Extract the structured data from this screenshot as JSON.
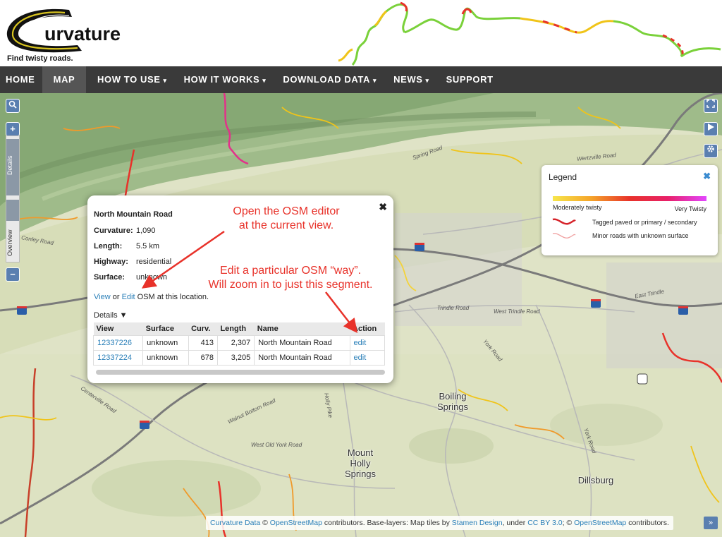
{
  "brand": {
    "name": "urvature",
    "tagline": "Find twisty roads."
  },
  "nav": [
    {
      "label": "HOME",
      "dropdown": false,
      "active": false
    },
    {
      "label": "MAP",
      "dropdown": false,
      "active": true
    },
    {
      "label": "HOW TO USE",
      "dropdown": true,
      "active": false
    },
    {
      "label": "HOW IT WORKS",
      "dropdown": true,
      "active": false
    },
    {
      "label": "DOWNLOAD DATA",
      "dropdown": true,
      "active": false
    },
    {
      "label": "NEWS",
      "dropdown": true,
      "active": false
    },
    {
      "label": "SUPPORT",
      "dropdown": false,
      "active": false
    }
  ],
  "map_controls": {
    "search_icon": "search-icon",
    "zoom_in": "+",
    "zoom_out": "−",
    "sidebar_tabs": [
      "Details",
      "Overview"
    ],
    "right_buttons": [
      "fullscreen-icon",
      "play-icon",
      "gear-icon"
    ]
  },
  "places": {
    "boiling_springs": "Boiling\nSprings",
    "mount_holly": "Mount\nHolly\nSprings",
    "dillsburg": "Dillsburg"
  },
  "road_labels": {
    "wertzville": "Wertzville Road",
    "spring": "Spring Road",
    "east_trindle": "East Trindle",
    "trindle": "Trindle Road",
    "west_trindle": "West Trindle Road",
    "york": "York Road",
    "holly_pike": "Holly Pike",
    "walnut_bottom": "Walnut Bottom Road",
    "centerville": "Centerville Road",
    "west_old_york": "West Old York Road",
    "conley": "Conley Road",
    "york_road_s": "York Road",
    "i76": "76",
    "i81": "81",
    "us15": "15"
  },
  "legend": {
    "title": "Legend",
    "close_label": "✖",
    "low_label": "Moderately twisty",
    "high_label": "Very Twisty",
    "paved_label": "Tagged paved or primary / secondary",
    "unknown_label": "Minor roads with unknown surface"
  },
  "popup": {
    "title": "North Mountain Road",
    "close_label": "✖",
    "fields": [
      {
        "key": "Curvature:",
        "value": "1,090"
      },
      {
        "key": "Length:",
        "value": "5.5 km"
      },
      {
        "key": "Highway:",
        "value": "residential"
      },
      {
        "key": "Surface:",
        "value": "unknown"
      }
    ],
    "view_link": "View",
    "or_text": "or",
    "edit_link": "Edit",
    "osm_text": "OSM at this location.",
    "details_label": "Details ▼",
    "table": {
      "headers": [
        "View",
        "Surface",
        "Curv.",
        "Length",
        "Name",
        "Action"
      ],
      "rows": [
        {
          "id": "12337226",
          "surface": "unknown",
          "curv": "413",
          "length": "2,307",
          "name": "North Mountain Road",
          "action": "edit"
        },
        {
          "id": "12337224",
          "surface": "unknown",
          "curv": "678",
          "length": "3,205",
          "name": "North Mountain Road",
          "action": "edit"
        }
      ]
    }
  },
  "annotations": {
    "osm_editor": "Open the OSM editor\nat the current view.",
    "osm_way": "Edit a particular OSM “way”.\nWill zoom in to just this segment."
  },
  "attribution": {
    "curvature_data": "Curvature Data",
    "copy1": "©",
    "osm1": "OpenStreetMap",
    "text1": "contributors. Base-layers: Map tiles by",
    "stamen": "Stamen Design",
    "text2": ", under",
    "ccby": "CC BY 3.0",
    "text3": "; ©",
    "osm2": "OpenStreetMap",
    "text4": "contributors.",
    "expand_label": "»"
  },
  "colors": {
    "nav_bg": "#3a3a3a",
    "link": "#2a7fb8",
    "annotation": "#e8322a",
    "control_blue": "#5a7fb0"
  }
}
